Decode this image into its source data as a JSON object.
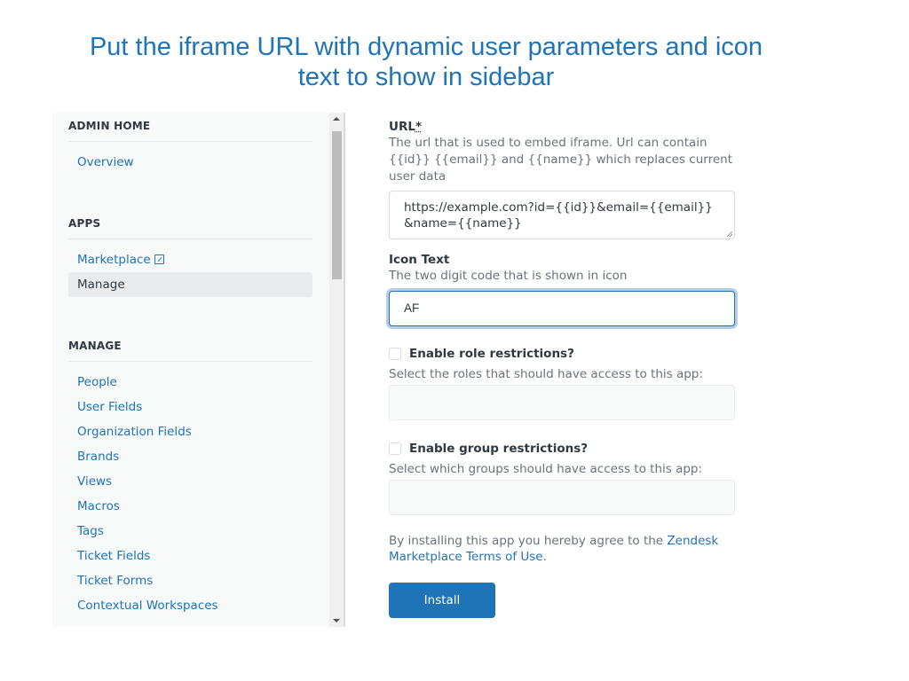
{
  "caption": {
    "line1": "Put the iframe URL with dynamic user parameters and icon",
    "line2": "text to show in sidebar"
  },
  "sidebar": {
    "sections": [
      {
        "title": "ADMIN HOME",
        "items": [
          {
            "label": "Overview"
          }
        ]
      },
      {
        "title": "APPS",
        "items": [
          {
            "label": "Marketplace",
            "icon": "external-link-icon"
          },
          {
            "label": "Manage",
            "active": true
          }
        ]
      },
      {
        "title": "MANAGE",
        "items": [
          {
            "label": "People"
          },
          {
            "label": "User Fields"
          },
          {
            "label": "Organization Fields"
          },
          {
            "label": "Brands"
          },
          {
            "label": "Views"
          },
          {
            "label": "Macros"
          },
          {
            "label": "Tags"
          },
          {
            "label": "Ticket Fields"
          },
          {
            "label": "Ticket Forms"
          },
          {
            "label": "Contextual Workspaces"
          }
        ]
      }
    ]
  },
  "form": {
    "url": {
      "label": "URL",
      "required_mark": "*",
      "hint": "The url that is used to embed iframe. Url can contain {{id}} {{email}} and {{name}} which replaces current user data",
      "value": "https://example.com?id={{id}}&email={{email}}&name={{name}}"
    },
    "icon_text": {
      "label": "Icon Text",
      "hint": "The two digit code that is shown in icon",
      "value": "AF"
    },
    "role_restrictions": {
      "label": "Enable role restrictions?",
      "checked": false,
      "hint": "Select the roles that should have access to this app:"
    },
    "group_restrictions": {
      "label": "Enable group restrictions?",
      "checked": false,
      "hint": "Select which groups should have access to this app:"
    },
    "terms": {
      "prefix": "By installing this app you hereby agree to the ",
      "link": "Zendesk Marketplace Terms of Use",
      "suffix": "."
    },
    "install_label": "Install"
  },
  "colors": {
    "accent": "#1f73b7",
    "text": "#2f3941",
    "hint": "#68737d"
  }
}
